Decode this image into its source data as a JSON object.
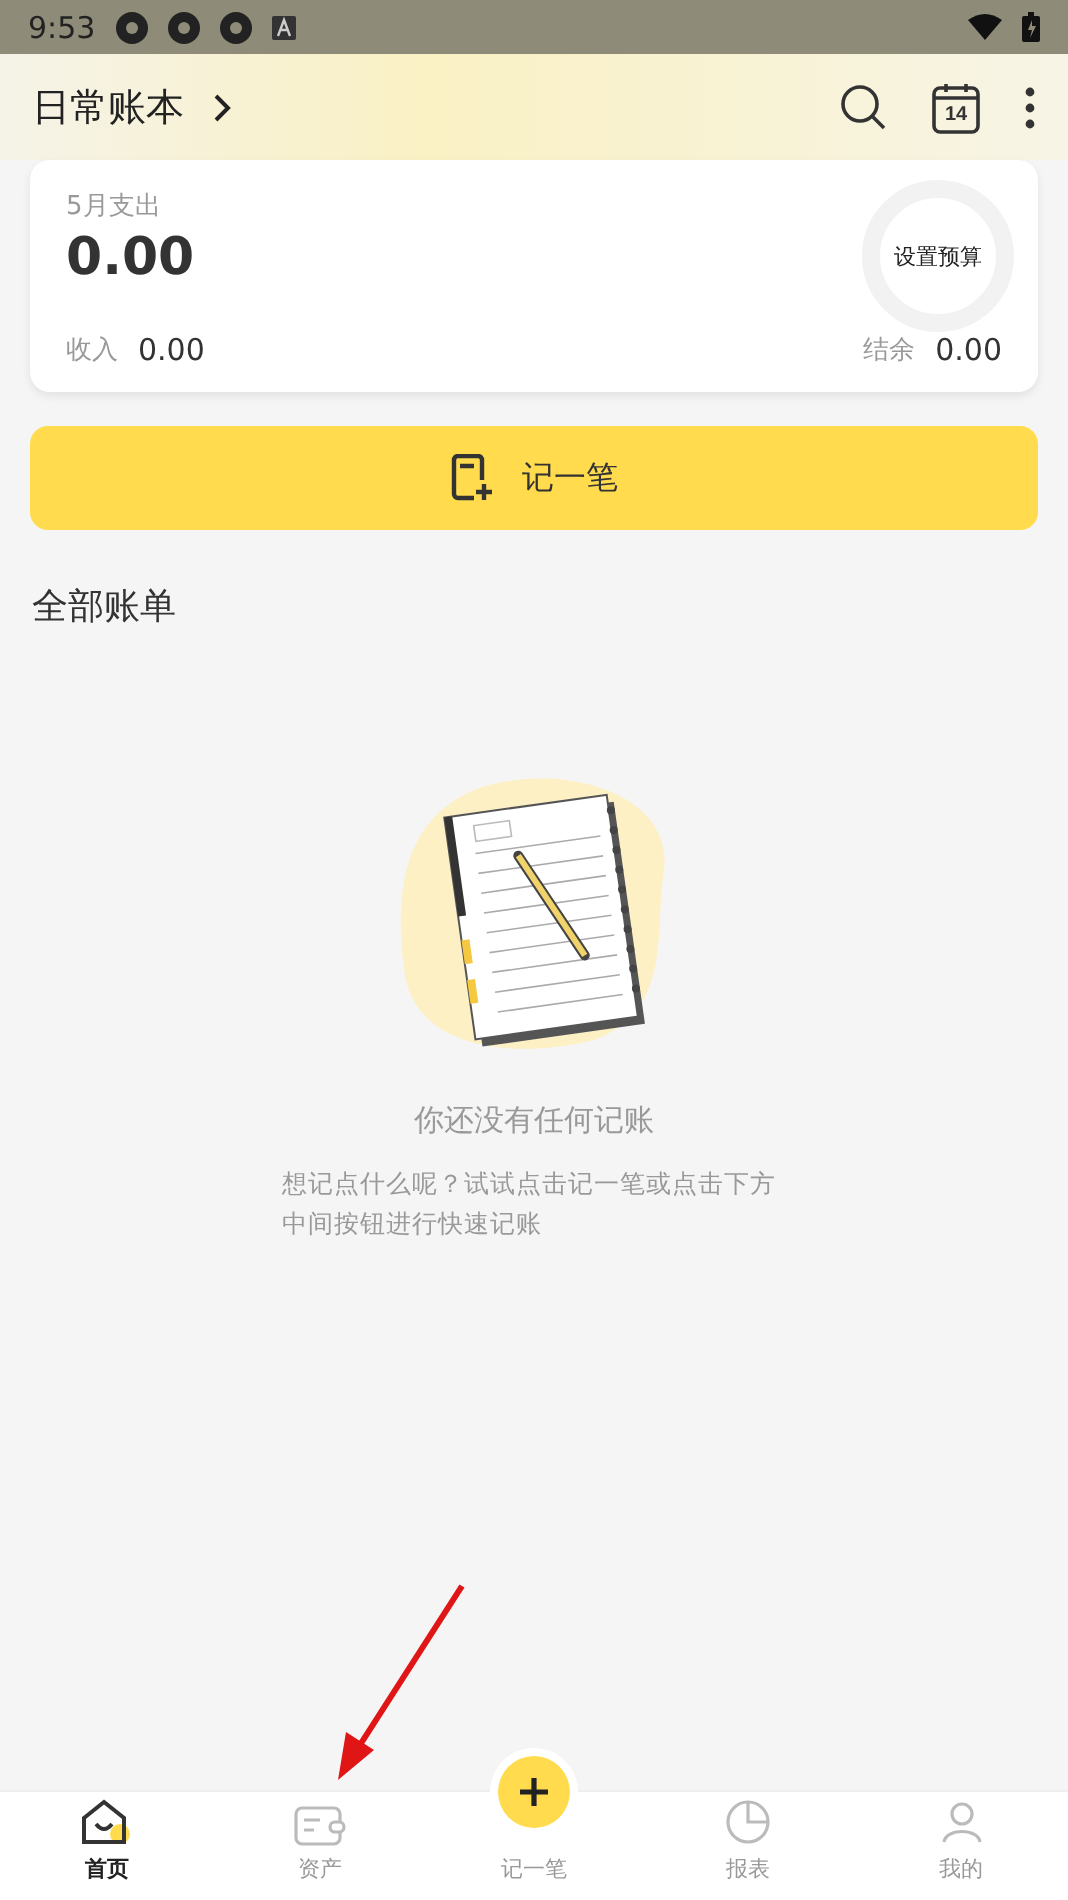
{
  "status_bar": {
    "time": "9:53"
  },
  "header": {
    "title": "日常账本"
  },
  "summary": {
    "label": "5月支出",
    "amount": "0.00",
    "budget": "设置预算",
    "income_label": "收入",
    "income": "0.00",
    "balance_label": "结余",
    "balance": "0.00"
  },
  "record_button": {
    "label": "记一笔"
  },
  "section_title": "全部账单",
  "empty": {
    "title": "你还没有任何记账",
    "text": "想记点什么呢？试试点击记一笔或点击下方中间按钮进行快速记账"
  },
  "calendar_day": "14",
  "nav": [
    {
      "label": "首页",
      "kind": "home",
      "selected": true
    },
    {
      "label": "资产",
      "kind": "wallet",
      "selected": false
    },
    {
      "label": "记一笔",
      "kind": "add",
      "selected": false
    },
    {
      "label": "报表",
      "kind": "report",
      "selected": false
    },
    {
      "label": "我的",
      "kind": "me",
      "selected": false
    }
  ]
}
